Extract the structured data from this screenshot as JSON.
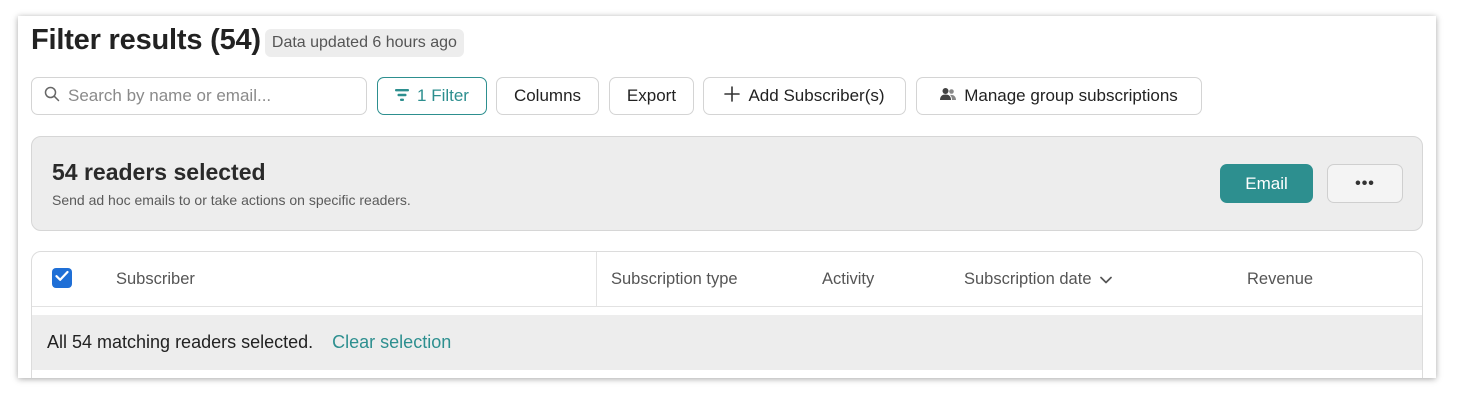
{
  "header": {
    "title": "Filter results (54)",
    "updated": "Data updated 6 hours ago"
  },
  "toolbar": {
    "search_placeholder": "Search by name or email...",
    "filter_label": "1 Filter",
    "columns_label": "Columns",
    "export_label": "Export",
    "add_label": "Add Subscriber(s)",
    "manage_label": "Manage group subscriptions"
  },
  "selection": {
    "title": "54 readers selected",
    "description": "Send ad hoc emails to or take actions on specific readers.",
    "email_label": "Email",
    "more_label": "•••"
  },
  "table": {
    "columns": {
      "subscriber": "Subscriber",
      "subscription_type": "Subscription type",
      "activity": "Activity",
      "subscription_date": "Subscription date",
      "revenue": "Revenue"
    },
    "select_all_checked": true,
    "banner_text": "All 54 matching readers selected.",
    "clear_label": "Clear selection"
  },
  "colors": {
    "accent": "#2d8f8f",
    "checkbox": "#1f6fd6",
    "panel_bg": "#ededed"
  },
  "icons": {
    "search": "search-icon",
    "filter": "filter-icon",
    "add": "plus-icon",
    "group": "users-icon",
    "sort": "chevron-down-icon",
    "check": "check-icon"
  }
}
